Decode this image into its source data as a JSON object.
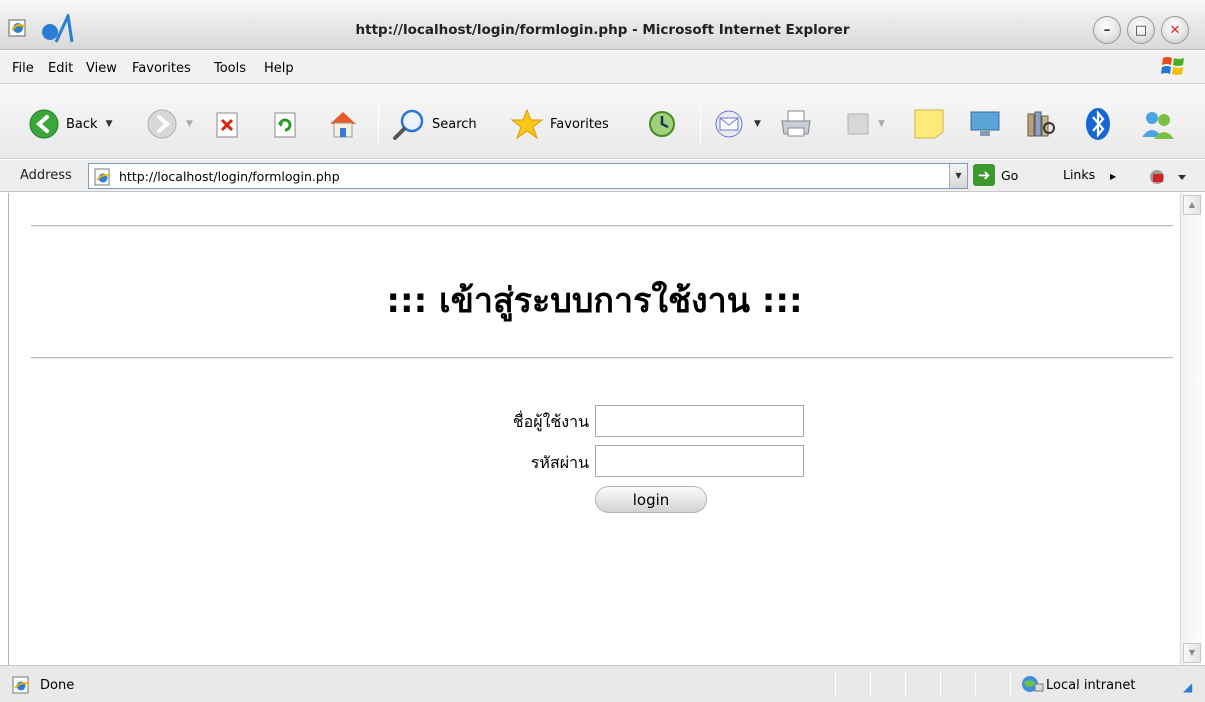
{
  "window": {
    "title": "http://localhost/login/formlogin.php - Microsoft Internet Explorer",
    "minimize": "–",
    "maximize": "□",
    "close": "✕"
  },
  "menu": {
    "items": [
      "File",
      "Edit",
      "View",
      "Favorites",
      "Tools",
      "Help"
    ]
  },
  "toolbar": {
    "back_label": "Back",
    "search_label": "Search",
    "favorites_label": "Favorites",
    "dropdown_glyph": "▼"
  },
  "address": {
    "label": "Address",
    "url": "http://localhost/login/formlogin.php",
    "go_label": "Go",
    "links_label": "Links",
    "links_arrow": "▶"
  },
  "page": {
    "heading": "::: เข้าสู่ระบบการใช้งาน :::",
    "username_label": "ชื่อผู้ใช้งาน",
    "username_value": "",
    "password_label": "รหัสผ่าน",
    "password_value": "",
    "login_label": "login"
  },
  "scrollbar": {
    "up": "▲",
    "down": "▼"
  },
  "status": {
    "text": "Done",
    "zone": "Local intranet",
    "grip": "◢"
  },
  "colors": {
    "accent_blue": "#2a7fd4",
    "go_green": "#3c9a2d",
    "close_red": "#dd2222"
  }
}
